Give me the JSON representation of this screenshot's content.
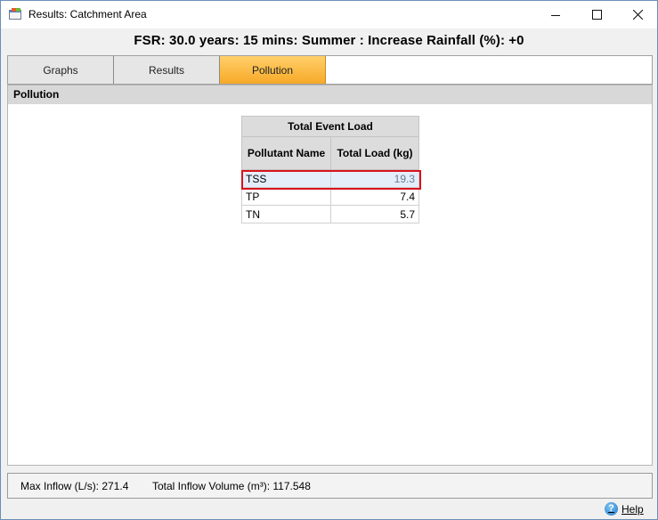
{
  "window": {
    "title": "Results: Catchment Area",
    "icon": "app-window-icon",
    "controls": [
      "minimize-icon",
      "maximize-icon",
      "close-icon"
    ]
  },
  "heading": "FSR: 30.0 years: 15 mins: Summer : Increase Rainfall (%): +0",
  "tabs": [
    {
      "label": "Graphs",
      "active": false
    },
    {
      "label": "Results",
      "active": false
    },
    {
      "label": "Pollution",
      "active": true
    }
  ],
  "section_title": "Pollution",
  "table": {
    "group_header": "Total Event Load",
    "columns": [
      "Pollutant Name",
      "Total Load (kg)"
    ],
    "rows": [
      {
        "name": "TSS",
        "load": "19.3",
        "selected": true
      },
      {
        "name": "TP",
        "load": "7.4",
        "selected": false
      },
      {
        "name": "TN",
        "load": "5.7",
        "selected": false
      }
    ]
  },
  "status": {
    "max_inflow": "Max Inflow (L/s): 271.4",
    "total_inflow_volume": "Total Inflow Volume (m³): 117.548"
  },
  "help": {
    "label": "Help",
    "icon": "help-icon"
  },
  "colors": {
    "active_tab": "#f7a928",
    "selection_outline": "#d8141c",
    "selection_fill": "#e4eefa"
  }
}
